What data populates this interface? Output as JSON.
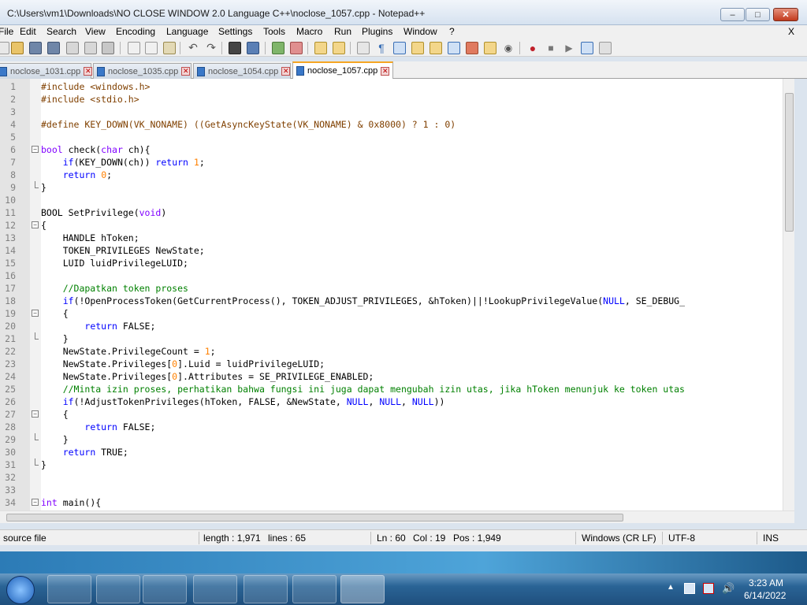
{
  "window": {
    "title": "C:\\Users\\vm1\\Downloads\\NO CLOSE WINDOW 2.0 Language C++\\noclose_1057.cpp - Notepad++"
  },
  "menu": {
    "items": [
      "File",
      "Edit",
      "Search",
      "View",
      "Encoding",
      "Language",
      "Settings",
      "Tools",
      "Macro",
      "Run",
      "Plugins",
      "Window",
      "?"
    ],
    "close": "X"
  },
  "tabs": [
    {
      "label": "noclose_1031.cpp",
      "active": false
    },
    {
      "label": "noclose_1035.cpp",
      "active": false
    },
    {
      "label": "noclose_1054.cpp",
      "active": false
    },
    {
      "label": "noclose_1057.cpp",
      "active": true
    }
  ],
  "editor": {
    "lines": [
      {
        "n": "1",
        "text": "#include <windows.h>"
      },
      {
        "n": "2",
        "text": "#include <stdio.h>"
      },
      {
        "n": "3",
        "text": ""
      },
      {
        "n": "4",
        "text": "#define KEY_DOWN(VK_NONAME) ((GetAsyncKeyState(VK_NONAME) & 0x8000) ? 1 : 0)"
      },
      {
        "n": "5",
        "text": ""
      },
      {
        "n": "6",
        "text": "bool check(char ch){"
      },
      {
        "n": "7",
        "text": "    if(KEY_DOWN(ch)) return 1;"
      },
      {
        "n": "8",
        "text": "    return 0;"
      },
      {
        "n": "9",
        "text": "}"
      },
      {
        "n": "10",
        "text": ""
      },
      {
        "n": "11",
        "text": "BOOL SetPrivilege(void)"
      },
      {
        "n": "12",
        "text": "{"
      },
      {
        "n": "13",
        "text": "    HANDLE hToken;"
      },
      {
        "n": "14",
        "text": "    TOKEN_PRIVILEGES NewState;"
      },
      {
        "n": "15",
        "text": "    LUID luidPrivilegeLUID;"
      },
      {
        "n": "16",
        "text": ""
      },
      {
        "n": "17",
        "text": "    //Dapatkan token proses"
      },
      {
        "n": "18",
        "text": "    if(!OpenProcessToken(GetCurrentProcess(), TOKEN_ADJUST_PRIVILEGES, &hToken)||!LookupPrivilegeValue(NULL, SE_DEBUG_"
      },
      {
        "n": "19",
        "text": "    {"
      },
      {
        "n": "20",
        "text": "        return FALSE;"
      },
      {
        "n": "21",
        "text": "    }"
      },
      {
        "n": "22",
        "text": "    NewState.PrivilegeCount = 1;"
      },
      {
        "n": "23",
        "text": "    NewState.Privileges[0].Luid = luidPrivilegeLUID;"
      },
      {
        "n": "24",
        "text": "    NewState.Privileges[0].Attributes = SE_PRIVILEGE_ENABLED;"
      },
      {
        "n": "25",
        "text": "    //Minta izin proses, perhatikan bahwa fungsi ini juga dapat mengubah izin utas, jika hToken menunjuk ke token utas"
      },
      {
        "n": "26",
        "text": "    if(!AdjustTokenPrivileges(hToken, FALSE, &NewState, NULL, NULL, NULL))"
      },
      {
        "n": "27",
        "text": "    {"
      },
      {
        "n": "28",
        "text": "        return FALSE;"
      },
      {
        "n": "29",
        "text": "    }"
      },
      {
        "n": "30",
        "text": "    return TRUE;"
      },
      {
        "n": "31",
        "text": "}"
      },
      {
        "n": "32",
        "text": ""
      },
      {
        "n": "33",
        "text": ""
      },
      {
        "n": "34",
        "text": "int main(){"
      }
    ]
  },
  "status": {
    "file_type": "C++ source file",
    "length": "length : 1,971",
    "lines": "lines : 65",
    "ln": "Ln : 60",
    "col": "Col : 19",
    "pos": "Pos : 1,949",
    "eol": "Windows (CR LF)",
    "encoding": "UTF-8",
    "mode": "INS"
  },
  "taskbar": {
    "time": "3:23 AM",
    "date": "6/14/2022"
  },
  "colors": {
    "keyword": "#8000ff",
    "type_keyword": "#0000ff",
    "preprocessor": "#804000",
    "number": "#ff8000",
    "comment": "#008000",
    "active_tab_accent": "#f5a623"
  }
}
